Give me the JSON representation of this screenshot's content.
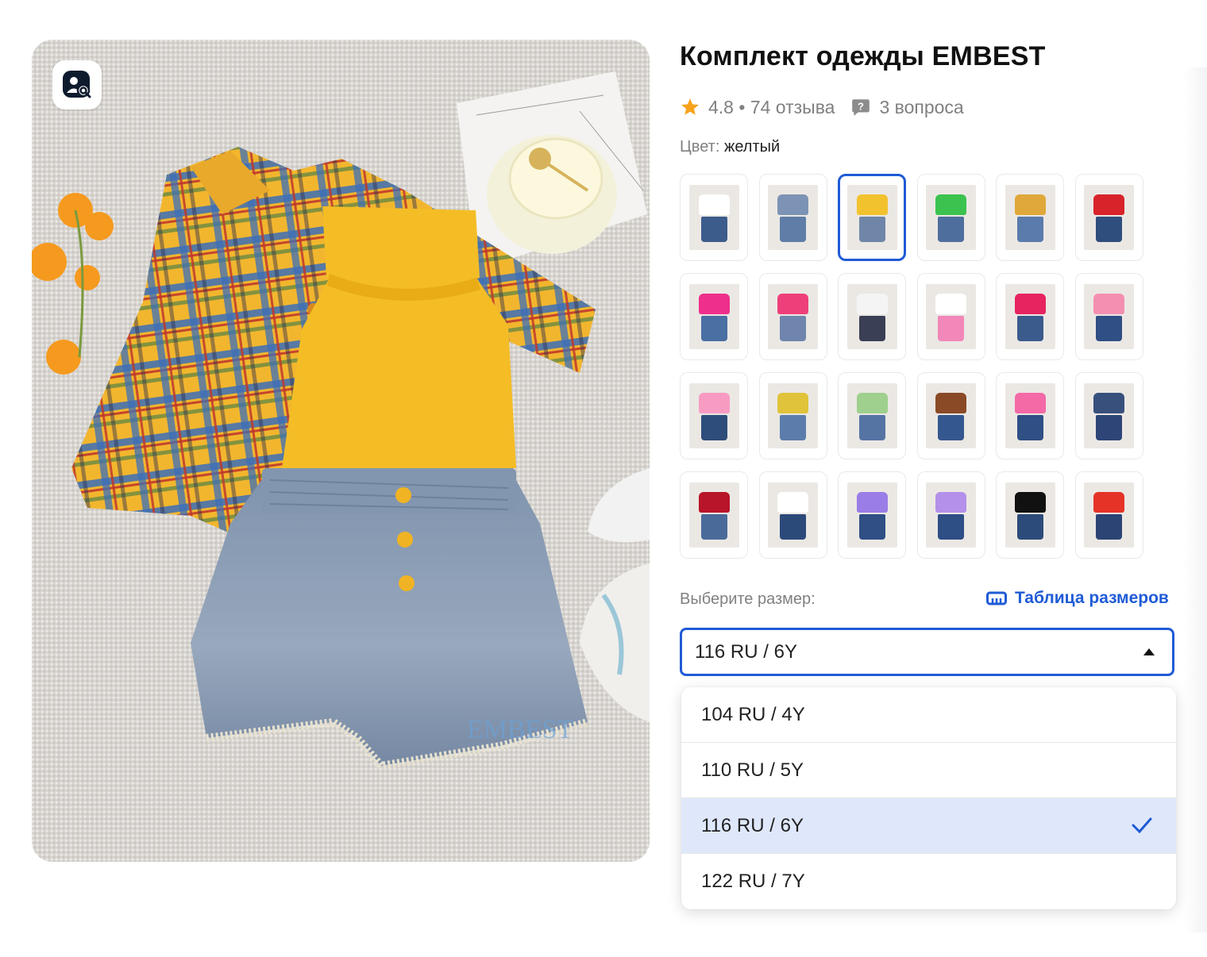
{
  "product": {
    "title": "Комплект одежды EMBEST",
    "rating": "4.8",
    "reviews_text": "• 74 отзыва",
    "questions_text": "3 вопроса",
    "image_watermark": "EMBEST",
    "image_search_icon": "image-search-icon"
  },
  "color": {
    "label": "Цвет:",
    "value": "желтый",
    "selected_index": 2,
    "variants": [
      {
        "top": "#ffffff",
        "bottom": "#3c5c8c"
      },
      {
        "top": "#7d93b5",
        "bottom": "#5f7da6"
      },
      {
        "top": "#f2c12e",
        "bottom": "#6f86a8"
      },
      {
        "top": "#3cc24e",
        "bottom": "#4e6f9e"
      },
      {
        "top": "#e0a83a",
        "bottom": "#5a7bab"
      },
      {
        "top": "#d9232a",
        "bottom": "#2f4d7d"
      },
      {
        "top": "#ee2f8b",
        "bottom": "#4a6fa3"
      },
      {
        "top": "#ef3f7a",
        "bottom": "#6f85ad"
      },
      {
        "top": "#f4f4f4",
        "bottom": "#3a3f55"
      },
      {
        "top": "#ffffff",
        "bottom": "#f287b9"
      },
      {
        "top": "#e7245f",
        "bottom": "#3b5b8c"
      },
      {
        "top": "#f48fb1",
        "bottom": "#2f4f85"
      },
      {
        "top": "#f89bc2",
        "bottom": "#2f4d7a"
      },
      {
        "top": "#e0c33a",
        "bottom": "#5c7dab"
      },
      {
        "top": "#9fd08d",
        "bottom": "#5574a4"
      },
      {
        "top": "#8a4a26",
        "bottom": "#35578f"
      },
      {
        "top": "#f36aa7",
        "bottom": "#2f4f85"
      },
      {
        "top": "#38507c",
        "bottom": "#2d4677"
      },
      {
        "top": "#b8142a",
        "bottom": "#4a6b9a"
      },
      {
        "top": "#ffffff",
        "bottom": "#2b4a7a"
      },
      {
        "top": "#9a7de6",
        "bottom": "#2f4f85"
      },
      {
        "top": "#b490ea",
        "bottom": "#2e4e86"
      },
      {
        "top": "#111111",
        "bottom": "#2d4b7a"
      },
      {
        "top": "#e63327",
        "bottom": "#2b4474"
      }
    ]
  },
  "size": {
    "label": "Выберите размер:",
    "table_link": "Таблица размеров",
    "selected": "116 RU / 6Y",
    "options": [
      "104 RU / 4Y",
      "110 RU / 5Y",
      "116 RU / 6Y",
      "122 RU / 7Y"
    ],
    "selected_index": 2
  },
  "colors": {
    "accent": "#1f5bd6",
    "active_option_bg": "#dfe8fb",
    "star": "#f7a21b"
  }
}
